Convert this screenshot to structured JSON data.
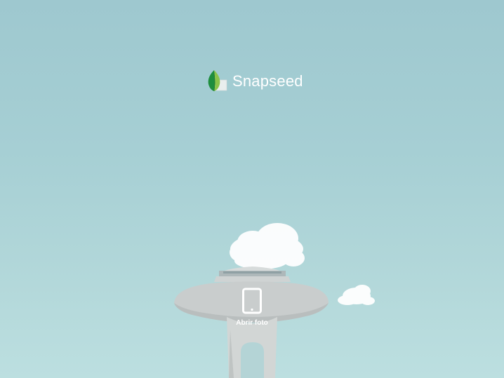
{
  "app": {
    "name": "Snapseed",
    "logo_icon": "snapseed-leaf-icon"
  },
  "main": {
    "open_photo": {
      "label": "Abrir foto",
      "icon": "tablet-icon"
    }
  },
  "colors": {
    "sky_top": "#9ec8cf",
    "sky_bottom": "#bcdfe0",
    "tower": "#c9cdcd",
    "leaf_dark": "#1e8e3e",
    "leaf_light": "#8bc34a"
  }
}
